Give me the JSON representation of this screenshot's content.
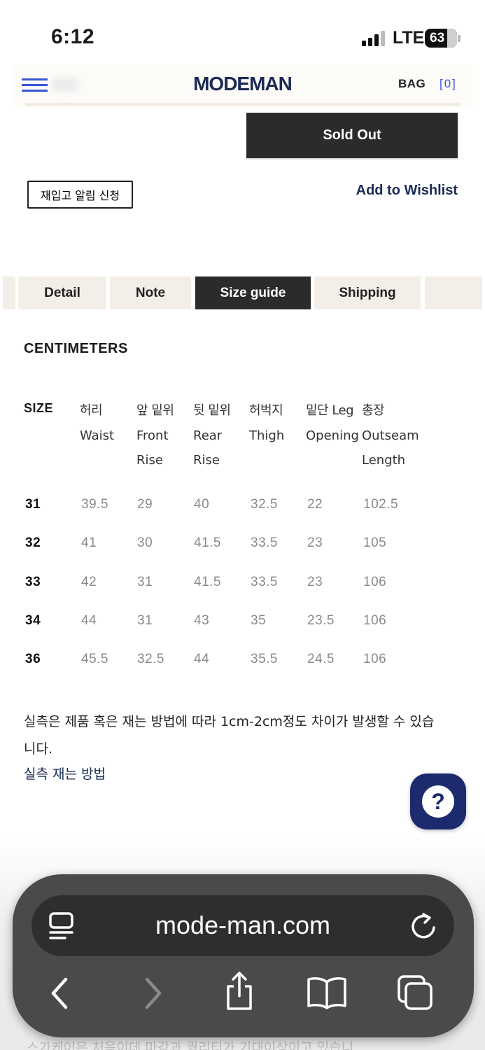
{
  "status_bar": {
    "time": "6:12",
    "network": "LTE",
    "battery": "63"
  },
  "header": {
    "logo": "MODEMAN",
    "bag_label": "BAG",
    "bag_count": "[0]"
  },
  "actions": {
    "sold_out": "Sold Out",
    "restock": "재입고 알림 신청",
    "wishlist": "Add to Wishlist"
  },
  "tabs": [
    {
      "label": "Detail",
      "active": false
    },
    {
      "label": "Note",
      "active": false
    },
    {
      "label": "Size guide",
      "active": true
    },
    {
      "label": "Shipping",
      "active": false
    }
  ],
  "size_guide": {
    "units": "CENTIMETERS",
    "columns": [
      {
        "ko": "SIZE",
        "en": ""
      },
      {
        "ko": "허리",
        "en": "Waist"
      },
      {
        "ko": "앞 밑위",
        "en": "Front\nRise"
      },
      {
        "ko": "뒷 밑위",
        "en": "Rear\nRise"
      },
      {
        "ko": "허벅지",
        "en": "Thigh"
      },
      {
        "ko": "밑단 Leg",
        "en": "Opening"
      },
      {
        "ko": "총장",
        "en": "Outseam\nLength"
      }
    ],
    "rows": [
      [
        "31",
        "39.5",
        "29",
        "40",
        "32.5",
        "22",
        "102.5"
      ],
      [
        "32",
        "41",
        "30",
        "41.5",
        "33.5",
        "23",
        "105"
      ],
      [
        "33",
        "42",
        "31",
        "41.5",
        "33.5",
        "23",
        "106"
      ],
      [
        "34",
        "44",
        "31",
        "43",
        "35",
        "23.5",
        "106"
      ],
      [
        "36",
        "45.5",
        "32.5",
        "44",
        "35.5",
        "24.5",
        "106"
      ]
    ],
    "note": "실측은 제품 혹은 재는 방법에 따라 1cm-2cm정도 차이가 발생할 수 있습니다.",
    "howto_link": "실측 재는 방법"
  },
  "help_button": {
    "label": "?"
  },
  "browser": {
    "url": "mode-man.com"
  },
  "peek_text": "스가케이은 처음이데 마감과 퀄리티가 기대이상이고 있습니",
  "colors": {
    "brand_navy": "#1c2b54",
    "accent_blue": "#3a56d4",
    "active_tab": "#2b2b2b",
    "tab_bg": "#f3eee8"
  },
  "icons": [
    "hamburger-icon",
    "help-icon",
    "reader-icon",
    "reload-icon",
    "back-icon",
    "forward-icon",
    "share-icon",
    "bookmarks-icon",
    "tabs-icon"
  ]
}
